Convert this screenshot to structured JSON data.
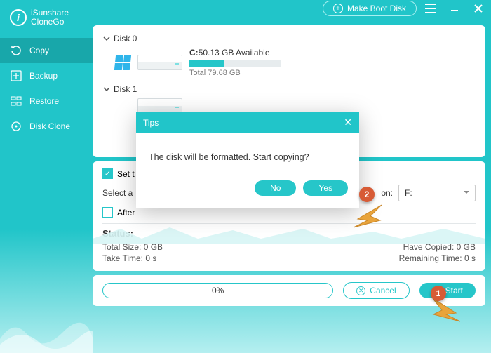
{
  "logo": {
    "l1": "iSunshare",
    "l2": "CloneGo"
  },
  "nav": {
    "copy": "Copy",
    "backup": "Backup",
    "restore": "Restore",
    "diskclone": "Disk Clone"
  },
  "top": {
    "boot": "Make Boot Disk"
  },
  "disks": {
    "d0": {
      "title": "Disk 0",
      "drive": "C:",
      "avail": "50.13 GB Available",
      "total": "Total 79.68 GB",
      "used_pct": 38
    },
    "d1": {
      "title": "Disk 1"
    }
  },
  "opts": {
    "set_label": "Set t",
    "select_label": "Select a",
    "after_label": "After",
    "part_suffix": "on:",
    "part_value": "F:"
  },
  "status": {
    "title": "Status:",
    "ts_label": "Total Size:",
    "ts_val": "0 GB",
    "hc_label": "Have Copied:",
    "hc_val": "0 GB",
    "tt_label": "Take Time:",
    "tt_val": "0 s",
    "rt_label": "Remaining Time:",
    "rt_val": "0 s"
  },
  "foot": {
    "pct": "0%",
    "cancel": "Cancel",
    "start": "Start"
  },
  "modal": {
    "title": "Tips",
    "body": "The disk will be formatted. Start copying?",
    "no": "No",
    "yes": "Yes"
  },
  "badges": {
    "b1": "1",
    "b2": "2"
  }
}
